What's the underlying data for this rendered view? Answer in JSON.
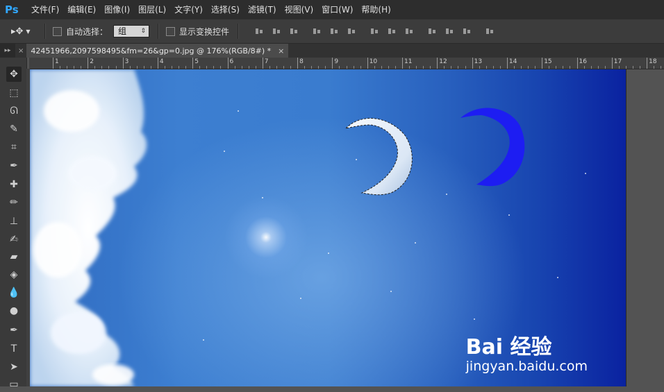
{
  "app": {
    "logo": "Ps"
  },
  "menu": [
    "文件(F)",
    "编辑(E)",
    "图像(I)",
    "图层(L)",
    "文字(Y)",
    "选择(S)",
    "滤镜(T)",
    "视图(V)",
    "窗口(W)",
    "帮助(H)"
  ],
  "options": {
    "auto_select_label": "自动选择：",
    "auto_select_value": "组",
    "show_transform_label": "显示变换控件"
  },
  "document": {
    "tab_title": "42451966,2097598495&fm=26&gp=0.jpg @ 176%(RGB/8#) *",
    "close": "×"
  },
  "ruler": {
    "labels": [
      "1",
      "2",
      "3",
      "4",
      "5",
      "6",
      "7",
      "8",
      "9",
      "10",
      "11",
      "12",
      "13",
      "14",
      "15",
      "16",
      "17",
      "18"
    ]
  },
  "tools": [
    {
      "name": "move-tool-icon",
      "glyph": "✥"
    },
    {
      "name": "marquee-tool-icon",
      "glyph": "⬚"
    },
    {
      "name": "lasso-tool-icon",
      "glyph": "ᘏ"
    },
    {
      "name": "quick-select-tool-icon",
      "glyph": "✎"
    },
    {
      "name": "crop-tool-icon",
      "glyph": "⌗"
    },
    {
      "name": "eyedropper-tool-icon",
      "glyph": "✒"
    },
    {
      "name": "healing-brush-tool-icon",
      "glyph": "✚"
    },
    {
      "name": "brush-tool-icon",
      "glyph": "✏"
    },
    {
      "name": "clone-stamp-tool-icon",
      "glyph": "⊥"
    },
    {
      "name": "history-brush-tool-icon",
      "glyph": "✍"
    },
    {
      "name": "eraser-tool-icon",
      "glyph": "▰"
    },
    {
      "name": "paint-bucket-tool-icon",
      "glyph": "◈"
    },
    {
      "name": "blur-tool-icon",
      "glyph": "💧"
    },
    {
      "name": "dodge-tool-icon",
      "glyph": "●"
    },
    {
      "name": "pen-tool-icon",
      "glyph": "✒"
    },
    {
      "name": "type-tool-icon",
      "glyph": "T"
    },
    {
      "name": "path-selection-tool-icon",
      "glyph": "➤"
    },
    {
      "name": "shape-tool-icon",
      "glyph": "▭"
    }
  ],
  "watermark": {
    "main": "Bai 经验",
    "sub": "jingyan.baidu.com"
  }
}
